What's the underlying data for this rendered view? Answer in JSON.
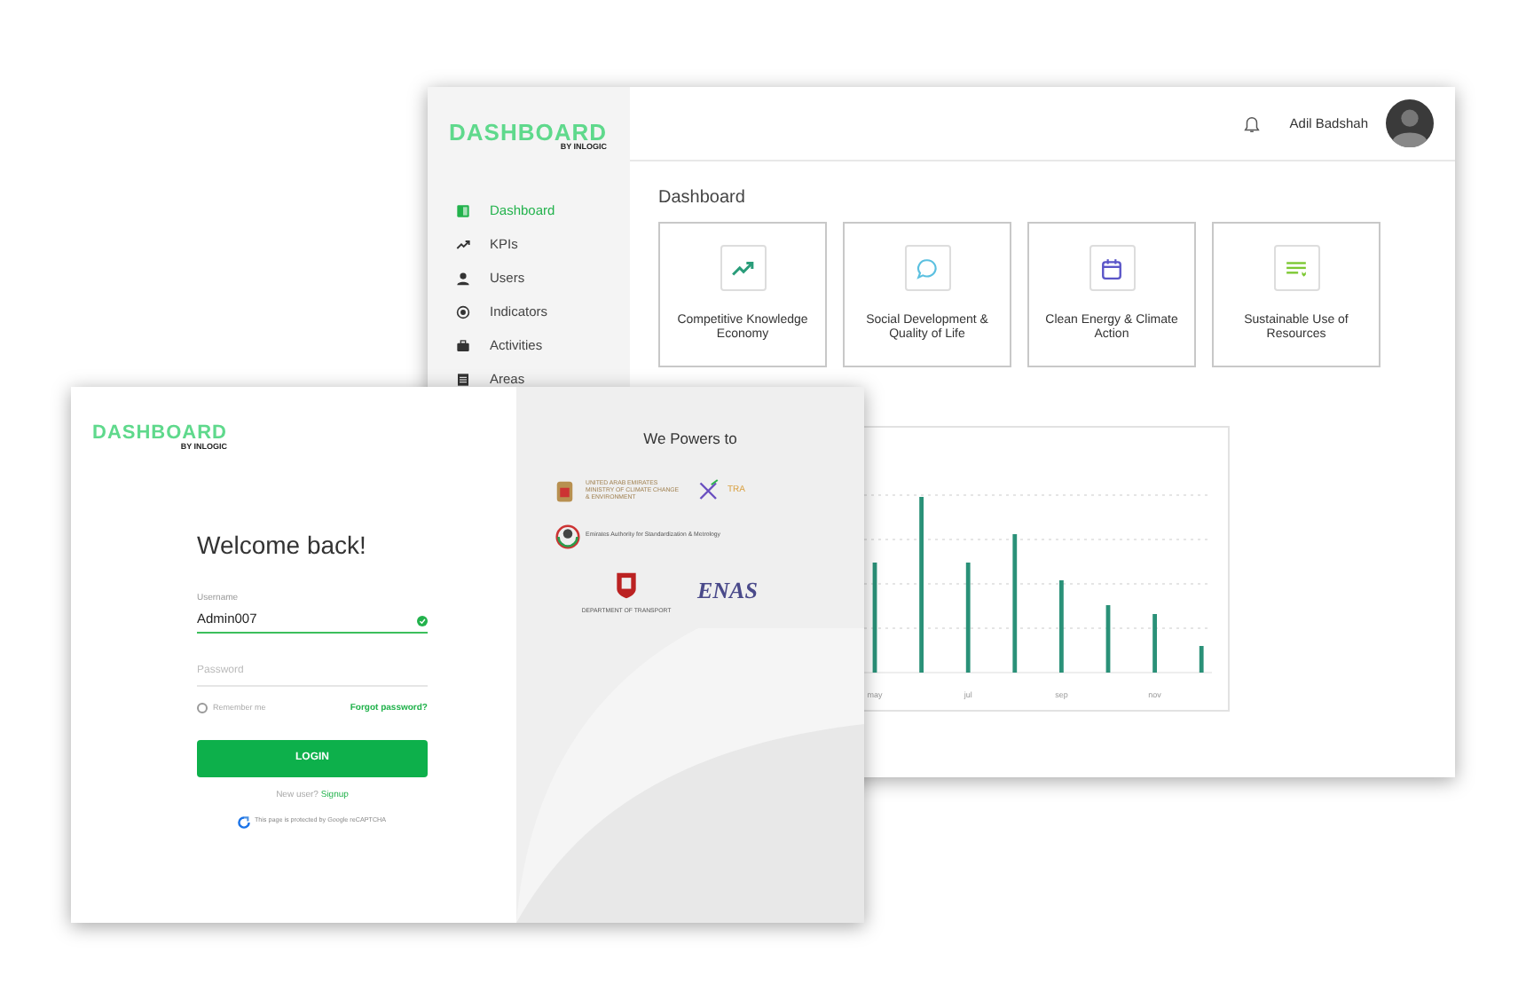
{
  "dashboard_window": {
    "logo": {
      "title": "DASHBOARD",
      "subtitle": "BY INLOGIC"
    },
    "user": {
      "name": "Adil Badshah"
    },
    "sidebar": {
      "items": [
        {
          "label": "Dashboard",
          "kind": "book",
          "selected": true
        },
        {
          "label": "KPIs",
          "kind": "trend",
          "selected": false
        },
        {
          "label": "Users",
          "kind": "user",
          "selected": false
        },
        {
          "label": "Indicators",
          "kind": "target",
          "selected": false
        },
        {
          "label": "Activities",
          "kind": "case",
          "selected": false
        },
        {
          "label": "Areas",
          "kind": "list",
          "selected": false
        }
      ]
    },
    "page_title": "Dashboard",
    "cards": [
      {
        "label": "Competitive Knowledge Economy",
        "kind": "trend",
        "color": "#2a9d7a"
      },
      {
        "label": "Social Development & Quality of Life",
        "kind": "chat",
        "color": "#5bc0e0"
      },
      {
        "label": "Clean Energy & Climate Action",
        "kind": "calendar",
        "color": "#5a55c8"
      },
      {
        "label": "Sustainable Use of Resources",
        "kind": "list",
        "color": "#7cc832"
      }
    ],
    "chart": {
      "x_labels": [
        "may",
        "jul",
        "sep",
        "nov"
      ]
    }
  },
  "login_window": {
    "logo": {
      "title": "DASHBOARD",
      "subtitle": "BY INLOGIC"
    },
    "heading": "Welcome back!",
    "username": {
      "label": "Username",
      "value": "Admin007",
      "valid": true
    },
    "password": {
      "placeholder": "Password"
    },
    "remember": {
      "label": "Remember me",
      "checked": false
    },
    "forgot_link": "Forgot password?",
    "login_button": "LOGIN",
    "signup_prompt": "New user?",
    "signup_link": "Signup",
    "recaptcha_note": "This page is protected by Google reCAPTCHA",
    "partners_title": "We Powers to",
    "partners": [
      {
        "kind": "ministry",
        "lines": [
          "UNITED ARAB EMIRATES",
          "MINISTRY OF CLIMATE CHANGE",
          "& ENVIRONMENT"
        ]
      },
      {
        "kind": "tra",
        "lines": [
          "TRA"
        ]
      },
      {
        "kind": "esma",
        "lines": [
          "Emirates Authority for Standardization & Metrology"
        ]
      },
      {
        "kind": "dot",
        "lines": [
          "DEPARTMENT OF TRANSPORT"
        ]
      },
      {
        "kind": "enas",
        "lines": [
          "ENAS"
        ]
      }
    ]
  }
}
